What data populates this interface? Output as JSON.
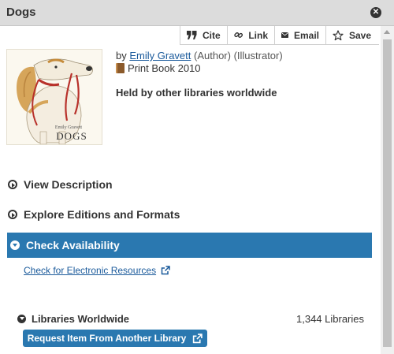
{
  "window": {
    "title": "Dogs"
  },
  "toolbar": {
    "cite_label": "Cite",
    "link_label": "Link",
    "email_label": "Email",
    "save_label": "Save"
  },
  "record": {
    "by_prefix": "by",
    "author": "Emily Gravett",
    "roles": "(Author) (Illustrator)",
    "format": "Print Book 2010",
    "held": "Held by other libraries worldwide",
    "cover_author_text": "Emily Gravett",
    "cover_title_text": "DOGS"
  },
  "sections": {
    "description": "View Description",
    "editions": "Explore Editions and Formats",
    "availability": "Check Availability"
  },
  "availability": {
    "electronic_link": "Check for Electronic Resources",
    "libraries_title": "Libraries Worldwide",
    "libraries_count": "1,344 Libraries",
    "request_button": "Request Item From Another Library"
  },
  "colors": {
    "accent": "#2a78b0",
    "link": "#1a5a9b",
    "titlebar": "#dcdcdc"
  },
  "icons": [
    "close-icon",
    "quote-icon",
    "link-icon",
    "envelope-icon",
    "star-icon",
    "book-icon",
    "external-link-icon",
    "expand-icon",
    "collapse-icon"
  ]
}
